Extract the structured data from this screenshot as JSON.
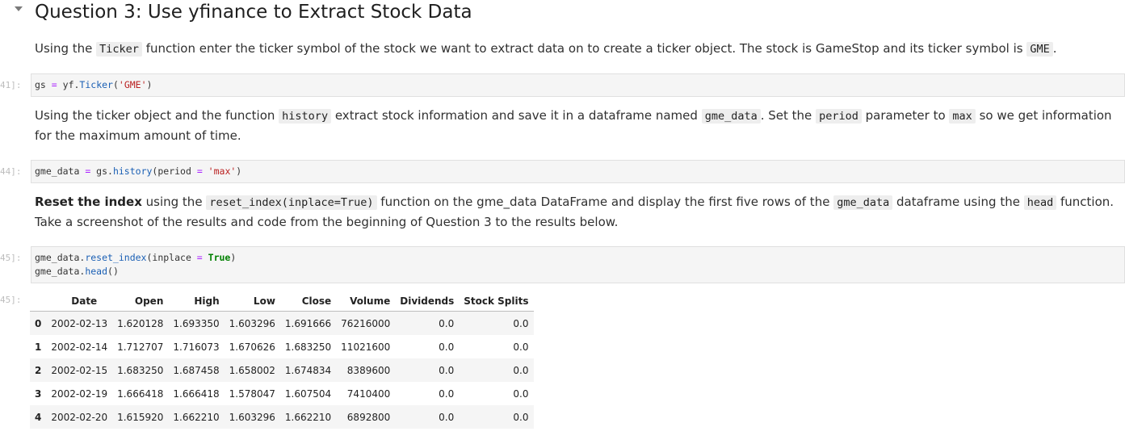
{
  "heading": "Question 3: Use yfinance to Extract Stock Data",
  "p1": {
    "t1": "Using the ",
    "c1": "Ticker",
    "t2": " function enter the ticker symbol of the stock we want to extract data on to create a ticker object. The stock is GameStop and its ticker symbol is ",
    "c2": "GME",
    "t3": "."
  },
  "cell1": {
    "prompt": "41]:",
    "v1": "gs",
    "op": " = ",
    "v2": "yf.",
    "fn": "Ticker",
    "p_open": "(",
    "str": "'GME'",
    "p_close": ")"
  },
  "p2": {
    "t1": "Using the ticker object and the function ",
    "c1": "history",
    "t2": " extract stock information and save it in a dataframe named ",
    "c2": "gme_data",
    "t3": ". Set the ",
    "c3": "period",
    "t4": " parameter to ",
    "c4": "max",
    "t5": " so we get information for the maximum amount of time."
  },
  "cell2": {
    "prompt": "44]:",
    "v1": "gme_data",
    "op1": " = ",
    "v2": "gs.",
    "fn": "history",
    "v3": "(period",
    "op2": " = ",
    "str": "'max'",
    "p_close": ")"
  },
  "p3": {
    "b1": "Reset the index",
    "t1": " using the ",
    "c1": "reset_index(inplace=True)",
    "t2": " function on the gme_data DataFrame and display the first five rows of the ",
    "c2": "gme_data",
    "t3": " dataframe using the ",
    "c3": "head",
    "t4": " function. Take a screenshot of the results and code from the beginning of Question 3 to the results below."
  },
  "cell3": {
    "prompt": "45]:",
    "l1_v1": "gme_data.",
    "l1_fn": "reset_index",
    "l1_v2": "(inplace",
    "l1_op": " = ",
    "l1_kw": "True",
    "l1_close": ")",
    "l2_v1": "gme_data.",
    "l2_fn": "head",
    "l2_close": "()"
  },
  "output": {
    "prompt": "45]:",
    "columns": [
      "",
      "Date",
      "Open",
      "High",
      "Low",
      "Close",
      "Volume",
      "Dividends",
      "Stock Splits"
    ],
    "rows": [
      [
        "0",
        "2002-02-13",
        "1.620128",
        "1.693350",
        "1.603296",
        "1.691666",
        "76216000",
        "0.0",
        "0.0"
      ],
      [
        "1",
        "2002-02-14",
        "1.712707",
        "1.716073",
        "1.670626",
        "1.683250",
        "11021600",
        "0.0",
        "0.0"
      ],
      [
        "2",
        "2002-02-15",
        "1.683250",
        "1.687458",
        "1.658002",
        "1.674834",
        "8389600",
        "0.0",
        "0.0"
      ],
      [
        "3",
        "2002-02-19",
        "1.666418",
        "1.666418",
        "1.578047",
        "1.607504",
        "7410400",
        "0.0",
        "0.0"
      ],
      [
        "4",
        "2002-02-20",
        "1.615920",
        "1.662210",
        "1.603296",
        "1.662210",
        "6892800",
        "0.0",
        "0.0"
      ]
    ]
  }
}
